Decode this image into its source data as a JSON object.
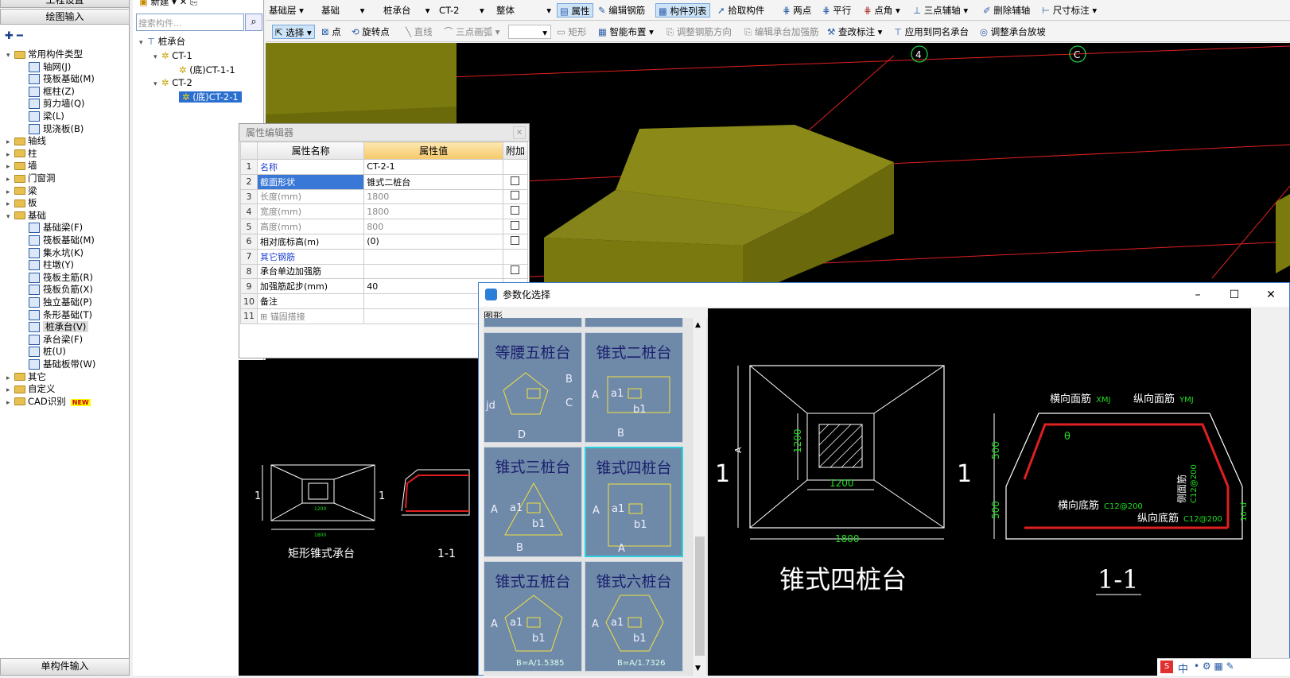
{
  "leftnav": {
    "top_btn": "工程设置",
    "draw_btn": "绘图输入",
    "bottom_btn": "单构件输入",
    "tree": [
      {
        "label": "常用构件类型",
        "indent": 0,
        "kind": "folder",
        "exp": "▾"
      },
      {
        "label": "轴网(J)",
        "indent": 2,
        "kind": "icon"
      },
      {
        "label": "筏板基础(M)",
        "indent": 2,
        "kind": "icon"
      },
      {
        "label": "框柱(Z)",
        "indent": 2,
        "kind": "icon"
      },
      {
        "label": "剪力墙(Q)",
        "indent": 2,
        "kind": "icon"
      },
      {
        "label": "梁(L)",
        "indent": 2,
        "kind": "icon"
      },
      {
        "label": "现浇板(B)",
        "indent": 2,
        "kind": "icon"
      },
      {
        "label": "轴线",
        "indent": 0,
        "kind": "folder",
        "exp": "▸"
      },
      {
        "label": "柱",
        "indent": 0,
        "kind": "folder",
        "exp": "▸"
      },
      {
        "label": "墙",
        "indent": 0,
        "kind": "folder",
        "exp": "▸"
      },
      {
        "label": "门窗洞",
        "indent": 0,
        "kind": "folder",
        "exp": "▸"
      },
      {
        "label": "梁",
        "indent": 0,
        "kind": "folder",
        "exp": "▸"
      },
      {
        "label": "板",
        "indent": 0,
        "kind": "folder",
        "exp": "▸"
      },
      {
        "label": "基础",
        "indent": 0,
        "kind": "folder",
        "exp": "▾"
      },
      {
        "label": "基础梁(F)",
        "indent": 2,
        "kind": "icon"
      },
      {
        "label": "筏板基础(M)",
        "indent": 2,
        "kind": "icon"
      },
      {
        "label": "集水坑(K)",
        "indent": 2,
        "kind": "icon"
      },
      {
        "label": "柱墩(Y)",
        "indent": 2,
        "kind": "icon"
      },
      {
        "label": "筏板主筋(R)",
        "indent": 2,
        "kind": "icon"
      },
      {
        "label": "筏板负筋(X)",
        "indent": 2,
        "kind": "icon"
      },
      {
        "label": "独立基础(P)",
        "indent": 2,
        "kind": "icon"
      },
      {
        "label": "条形基础(T)",
        "indent": 2,
        "kind": "icon"
      },
      {
        "label": "桩承台(V)",
        "indent": 2,
        "kind": "icon",
        "selected": true
      },
      {
        "label": "承台梁(F)",
        "indent": 2,
        "kind": "icon"
      },
      {
        "label": "桩(U)",
        "indent": 2,
        "kind": "icon"
      },
      {
        "label": "基础板带(W)",
        "indent": 2,
        "kind": "icon"
      },
      {
        "label": "其它",
        "indent": 0,
        "kind": "folder",
        "exp": "▸"
      },
      {
        "label": "自定义",
        "indent": 0,
        "kind": "folder",
        "exp": "▸"
      },
      {
        "label": "CAD识别",
        "indent": 0,
        "kind": "folder",
        "exp": "▸",
        "badge": "NEW"
      }
    ]
  },
  "comptree": {
    "new_btn": "新建",
    "search_placeholder": "搜索构件...",
    "root": "桩承台",
    "ct1": "CT-1",
    "ct1_child": "(底)CT-1-1",
    "ct2": "CT-2",
    "ct2_child": "(底)CT-2-1"
  },
  "toolbar1": {
    "floor": "基础层",
    "category": "基础",
    "type": "桩承台",
    "component": "CT-2",
    "scope": "整体",
    "attr": "属性",
    "edit_rebar": "编辑钢筋",
    "comp_list": "构件列表",
    "pick": "拾取构件",
    "two_point": "两点",
    "parallel": "平行",
    "point_angle": "点角",
    "three_point_aux": "三点辅轴",
    "delete_aux": "删除辅轴",
    "dimension": "尺寸标注"
  },
  "toolbar2": {
    "select": "选择",
    "point": "点",
    "rotate_point": "旋转点",
    "line": "直线",
    "arc": "三点画弧",
    "rect": "矩形",
    "smart": "智能布置",
    "adjust_dir": "调整钢筋方向",
    "edit_reinf": "编辑承台加强筋",
    "check": "查改标注",
    "apply_same": "应用到同名承台",
    "adjust_slope": "调整承台放坡"
  },
  "viewport": {
    "axis_4": "4",
    "axis_c": "C",
    "block_color": "#7b7a0e",
    "block_top": "#8b8a18"
  },
  "propwin": {
    "title": "属性编辑器",
    "col_name": "属性名称",
    "col_value": "属性值",
    "col_attach": "附加",
    "rows": [
      {
        "n": "1",
        "name": "名称",
        "value": "CT-2-1",
        "style": "link",
        "check": false
      },
      {
        "n": "2",
        "name": "截面形状",
        "value": "锥式二桩台",
        "style": "selected",
        "check": true
      },
      {
        "n": "3",
        "name": "长度(mm)",
        "value": "1800",
        "style": "gray",
        "check": true
      },
      {
        "n": "4",
        "name": "宽度(mm)",
        "value": "1800",
        "style": "gray",
        "check": true
      },
      {
        "n": "5",
        "name": "高度(mm)",
        "value": "800",
        "style": "gray",
        "check": true
      },
      {
        "n": "6",
        "name": "相对底标高(m)",
        "value": "(0)",
        "style": "normal",
        "check": true
      },
      {
        "n": "7",
        "name": "其它钢筋",
        "value": "",
        "style": "link",
        "check": false
      },
      {
        "n": "8",
        "name": "承台单边加强筋",
        "value": "",
        "style": "normal",
        "check": true
      },
      {
        "n": "9",
        "name": "加强筋起步(mm)",
        "value": "40",
        "style": "normal",
        "check": false
      },
      {
        "n": "10",
        "name": "备注",
        "value": "",
        "style": "normal",
        "check": false
      },
      {
        "n": "11",
        "name": "锚固搭接",
        "value": "",
        "style": "gray",
        "check": false,
        "plus": true
      }
    ]
  },
  "preview": {
    "caption": "矩形锥式承台",
    "section": "1-1",
    "mark_1": "1",
    "dim_1200": "1200",
    "dim_1800": "1800"
  },
  "paramwin": {
    "title": "参数化选择",
    "minimize": "–",
    "maximize": "☐",
    "close": "✕",
    "tab": "图形",
    "thumbs": [
      {
        "title": "等腰五桩台",
        "labels": [
          "B",
          "C",
          "jd",
          "D"
        ]
      },
      {
        "title": "锥式二桩台",
        "labels": [
          "A",
          "a1",
          "b1",
          "B"
        ]
      },
      {
        "title": "锥式三桩台",
        "labels": [
          "A",
          "a1",
          "b1",
          "B"
        ]
      },
      {
        "title": "锥式四桩台",
        "labels": [
          "A",
          "a1",
          "b1",
          "A"
        ],
        "selected": true
      },
      {
        "title": "锥式五桩台",
        "labels": [
          "A",
          "a1",
          "b1",
          "B=A/1.5385"
        ]
      },
      {
        "title": "锥式六桩台",
        "labels": [
          "A",
          "a1",
          "b1",
          "B=A/1.7326"
        ]
      }
    ]
  },
  "bigpreview": {
    "name": "锥式四桩台",
    "section": "1-1",
    "mark": "1",
    "dim_1200": "1200",
    "dim_1200b": "1200",
    "dim_1800": "1800",
    "dim_a": "A",
    "d500a": "500",
    "d500b": "500",
    "lbl_h_top": "横向面筋",
    "lbl_h_top_code": "XMJ",
    "lbl_v_top": "纵向面筋",
    "lbl_v_top_code": "YMJ",
    "lbl_side": "侧面筋",
    "lbl_side_code": "C12@200",
    "lbl_h_bot": "横向底筋",
    "lbl_h_bot_code": "C12@200",
    "lbl_v_bot": "纵向底筋",
    "lbl_v_bot_code": "C12@200",
    "lbl_theta": "θ",
    "lbl_d": "10*d"
  },
  "pctray": {
    "ime": "中",
    "icons": "• ⚙ ▦ ✎"
  }
}
